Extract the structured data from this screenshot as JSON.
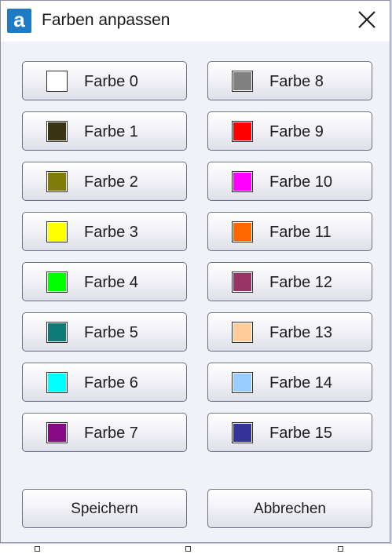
{
  "window": {
    "title": "Farben anpassen",
    "app_icon_letter": "a",
    "close_glyph": "close-icon"
  },
  "colors": [
    {
      "label": "Farbe 0",
      "color": "#ffffff"
    },
    {
      "label": "Farbe 1",
      "color": "#3a3414"
    },
    {
      "label": "Farbe 2",
      "color": "#817b08"
    },
    {
      "label": "Farbe 3",
      "color": "#ffff00"
    },
    {
      "label": "Farbe 4",
      "color": "#00ff00"
    },
    {
      "label": "Farbe 5",
      "color": "#0e7a76"
    },
    {
      "label": "Farbe 6",
      "color": "#00ffff"
    },
    {
      "label": "Farbe 7",
      "color": "#860986"
    },
    {
      "label": "Farbe 8",
      "color": "#808080"
    },
    {
      "label": "Farbe 9",
      "color": "#ff0000"
    },
    {
      "label": "Farbe 10",
      "color": "#ff00ff"
    },
    {
      "label": "Farbe 11",
      "color": "#ff6600"
    },
    {
      "label": "Farbe 12",
      "color": "#993366"
    },
    {
      "label": "Farbe 13",
      "color": "#ffcc99"
    },
    {
      "label": "Farbe 14",
      "color": "#99ccff"
    },
    {
      "label": "Farbe 15",
      "color": "#333399"
    }
  ],
  "actions": {
    "save_label": "Speichern",
    "cancel_label": "Abbrechen"
  }
}
